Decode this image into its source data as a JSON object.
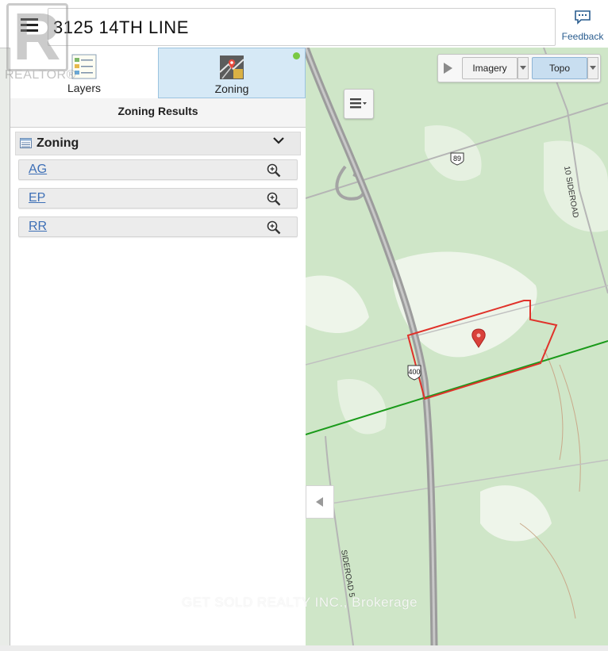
{
  "header": {
    "address": "3125 14TH LINE",
    "feedback_label": "Feedback",
    "menu_icon": "hamburger-menu-icon",
    "logo_text": "REALTOR®"
  },
  "tabs": [
    {
      "label": "Layers",
      "icon": "layers-icon",
      "active": false
    },
    {
      "label": "Zoning",
      "icon": "zoning-icon",
      "active": true
    }
  ],
  "results": {
    "title": "Zoning Results",
    "section_title": "Zoning",
    "section_icon": "table-icon",
    "zones": [
      {
        "code": "AG",
        "icon": "zoom-in-icon"
      },
      {
        "code": "EP",
        "icon": "zoom-in-icon"
      },
      {
        "code": "RR",
        "icon": "zoom-in-icon"
      }
    ]
  },
  "map": {
    "basemaps": [
      "Imagery",
      "Topo"
    ],
    "selected_basemap": "Topo",
    "labels": {
      "highway_400": "400",
      "highway_89": "89",
      "road_10_sideroad": "10 SIDEROAD",
      "road_sideroad_5": "SIDEROAD 5"
    },
    "watermark": "GET SOLD REALTY INC., Brokerage",
    "colors": {
      "parcel_outline": "#e0322a",
      "boundary_line": "#1a9a1a",
      "forest": "#cfe6c8",
      "open_land": "#f1f6ee",
      "highway": "#9c9c9c"
    }
  },
  "colors": {
    "active_tab": "#d6e9f6",
    "link": "#3d6fb6",
    "status_dot": "#7ac943"
  }
}
